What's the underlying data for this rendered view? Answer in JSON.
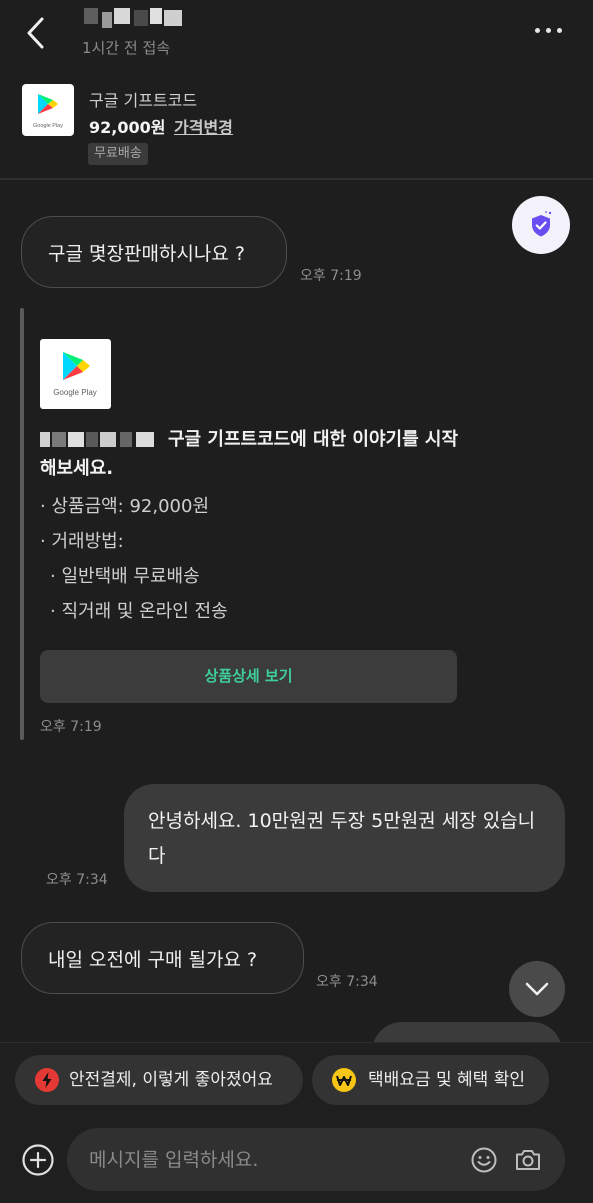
{
  "header": {
    "last_seen": "1시간 전 접속",
    "back_icon": "chevron-left-icon",
    "more_icon": "more-dots-icon"
  },
  "product": {
    "name": "구글 기프트코드",
    "price": "92,000원",
    "price_change": "가격변경",
    "shipping_badge": "무료배송",
    "logo_caption": "Google Play"
  },
  "messages": {
    "m1": {
      "text": "구글 몇장판매하시나요 ?",
      "time": "오후 7:19"
    },
    "card": {
      "logo_caption": "Google Play",
      "title": "구글 기프트코드에 대한 이야기를 시작해보세요.",
      "line1": "· 상품금액: 92,000원",
      "line2": "· 거래방법:",
      "line3": "· 일반택배 무료배송",
      "line4": "· 직거래 및 온라인 전송",
      "button": "상품상세 보기",
      "time": "오후 7:19"
    },
    "m2": {
      "text": "안녕하세요. 10만원권 두장 5만원권 세장 있습니다",
      "time": "오후 7:34"
    },
    "m3": {
      "text": "내일 오전에 구매 될가요 ?",
      "time": "오후 7:34"
    }
  },
  "chips": {
    "chip1": "안전결제, 이렇게 좋아졌어요",
    "chip2": "택배요금 및 혜택 확인"
  },
  "composer": {
    "placeholder": "메시지를 입력하세요."
  },
  "colors": {
    "background": "#1e1e1e",
    "accent_green": "#3ecf9a",
    "shield_purple": "#6a4df0"
  }
}
